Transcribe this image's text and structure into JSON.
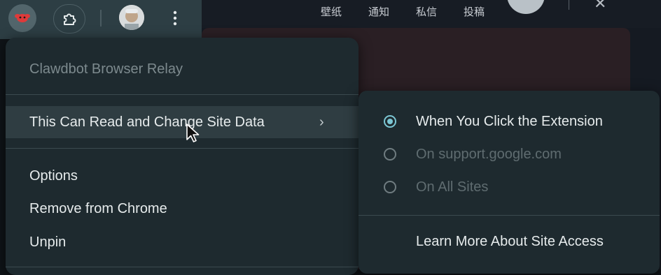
{
  "browser_toolbar": {
    "extension_icon": "lobster-icon",
    "puzzle_icon": "puzzle-icon",
    "avatar": "profile-avatar",
    "more_icon": "more-vert-icon"
  },
  "web_nav": {
    "items": [
      "壁纸",
      "通知",
      "私信",
      "投稿"
    ]
  },
  "context_menu": {
    "title": "Clawdbot Browser Relay",
    "items": [
      {
        "label": "This Can Read and Change Site Data",
        "chevron": "›"
      },
      {
        "label": "Options"
      },
      {
        "label": "Remove from Chrome"
      },
      {
        "label": "Unpin"
      }
    ]
  },
  "site_access_menu": {
    "options": [
      {
        "label": "When You Click the Extension",
        "selected": true,
        "enabled": true
      },
      {
        "label": "On support.google.com",
        "selected": false,
        "enabled": false
      },
      {
        "label": "On All Sites",
        "selected": false,
        "enabled": false
      }
    ],
    "learn_more": "Learn More About Site Access"
  },
  "colors": {
    "menu_bg": "#1e2a2f",
    "accent": "#7cc7d4",
    "toolbar_bg": "#2d3e44"
  }
}
